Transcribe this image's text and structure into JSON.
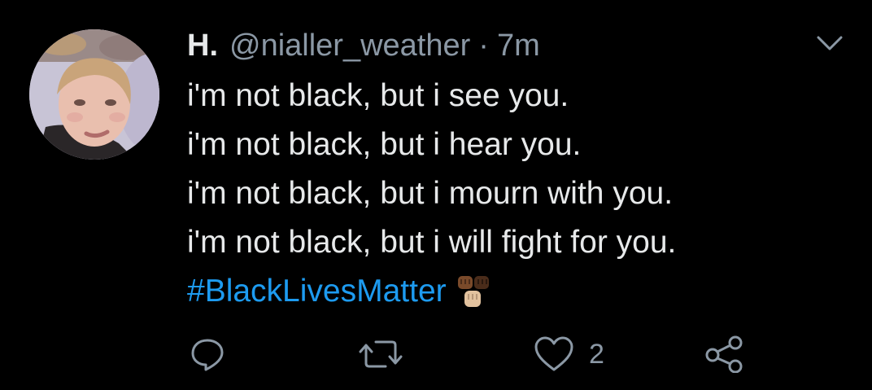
{
  "tweet": {
    "display_name": "H.",
    "handle": "@nialler_weather",
    "separator": "·",
    "timestamp": "7m",
    "lines": [
      "i'm not black, but i see you.",
      "i'm not black, but i hear you.",
      "i'm not black, but i mourn with you.",
      "i'm not black, but i will fight for you."
    ],
    "hashtag": "#BlackLivesMatter",
    "emoji": "raised-fists-emoji"
  },
  "actions": {
    "reply_icon": "reply-icon",
    "retweet_icon": "retweet-icon",
    "like_icon": "heart-icon",
    "like_count": "2",
    "share_icon": "share-icon"
  },
  "colors": {
    "background": "#000000",
    "text": "#e7e9ea",
    "secondary": "#8b98a5",
    "link": "#1d9bf0"
  }
}
